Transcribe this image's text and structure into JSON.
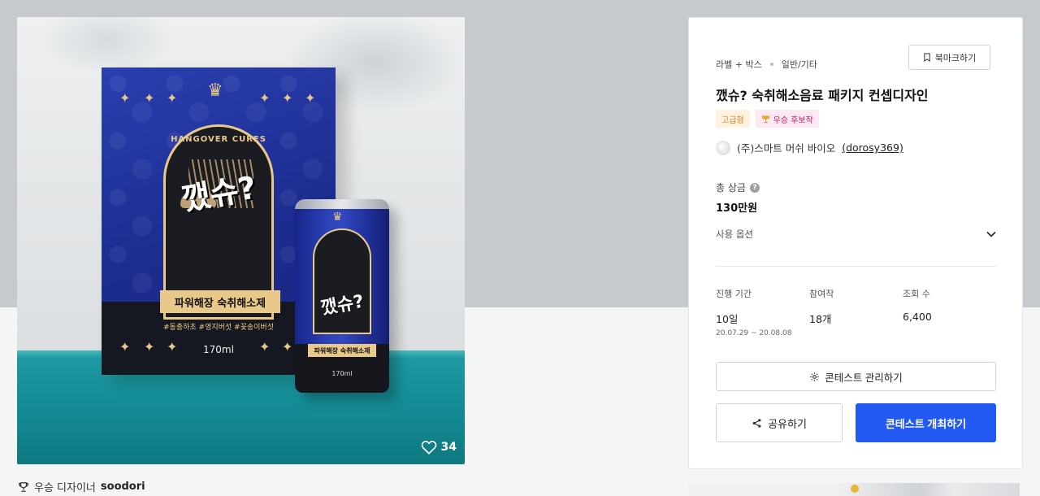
{
  "product_image": {
    "box": {
      "headline": "HANGOVER CURES",
      "brand": "깼슈?",
      "ribbon": "파워해장 숙취해소제",
      "tags": "#동충하초 #영지버섯 #꽃송이버섯",
      "volume": "170ml"
    },
    "can": {
      "brand": "깼슈?",
      "ribbon": "파워해장 숙취해소제",
      "volume": "170ml"
    },
    "likes": "34"
  },
  "winner": {
    "label": "우승 디자이너",
    "name": "soodori"
  },
  "panel": {
    "category_main": "라벨 + 박스",
    "category_sub": "일반/기타",
    "bookmark_label": "북마크하기",
    "title": "깼슈? 숙취해소음료 패키지 컨셉디자인",
    "badge_premium": "고급형",
    "badge_candidate": "우승 후보작",
    "company_name": "(주)스마트 머쉬 바이오",
    "company_id": "(dorosy369)",
    "prize_label": "총 상금",
    "prize_value": "130만원",
    "options_label": "사용 옵션",
    "stats": [
      {
        "label": "진행 기간",
        "value": "10일",
        "range": "20.07.29 ~ 20.08.08"
      },
      {
        "label": "참여작",
        "value": "18개"
      },
      {
        "label": "조회 수",
        "value": "6,400"
      }
    ],
    "manage_label": "콘테스트 관리하기",
    "share_label": "공유하기",
    "host_label": "콘테스트 개최하기"
  },
  "colors": {
    "primary_button": "#2259f2",
    "premium_badge_text": "#d9822b",
    "candidate_badge_text": "#c2185b"
  },
  "icons": [
    "heart-icon",
    "trophy-icon",
    "bookmark-icon",
    "help-icon",
    "chevron-down-icon",
    "gear-icon",
    "share-icon"
  ]
}
